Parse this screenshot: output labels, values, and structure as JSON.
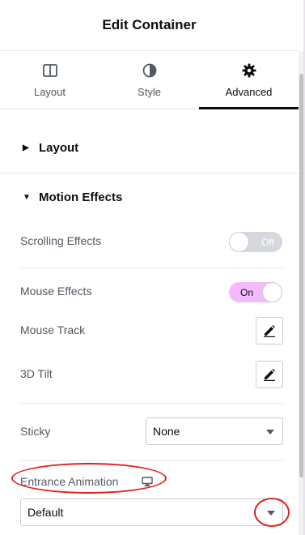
{
  "header": {
    "title": "Edit Container"
  },
  "tabs": [
    {
      "label": "Layout",
      "icon": "columns-icon",
      "active": false
    },
    {
      "label": "Style",
      "icon": "half-circle-icon",
      "active": false
    },
    {
      "label": "Advanced",
      "icon": "gear-icon",
      "active": true
    }
  ],
  "sections": {
    "layout": {
      "title": "Layout",
      "expanded": false
    },
    "motion_effects": {
      "title": "Motion Effects",
      "expanded": true
    }
  },
  "motion": {
    "scrolling_effects": {
      "label": "Scrolling Effects",
      "state": "Off"
    },
    "mouse_effects": {
      "label": "Mouse Effects",
      "state": "On"
    },
    "mouse_track": {
      "label": "Mouse Track",
      "icon": "pencil-icon"
    },
    "tilt_3d": {
      "label": "3D Tilt",
      "icon": "pencil-icon"
    },
    "sticky": {
      "label": "Sticky",
      "value": "None"
    },
    "entrance_animation": {
      "label": "Entrance Animation",
      "icon": "desktop-icon",
      "value": "Default"
    }
  },
  "colors": {
    "toggle_on": "#f3bafd",
    "toggle_off": "#d5d8dc",
    "annotation": "#e0201c"
  }
}
